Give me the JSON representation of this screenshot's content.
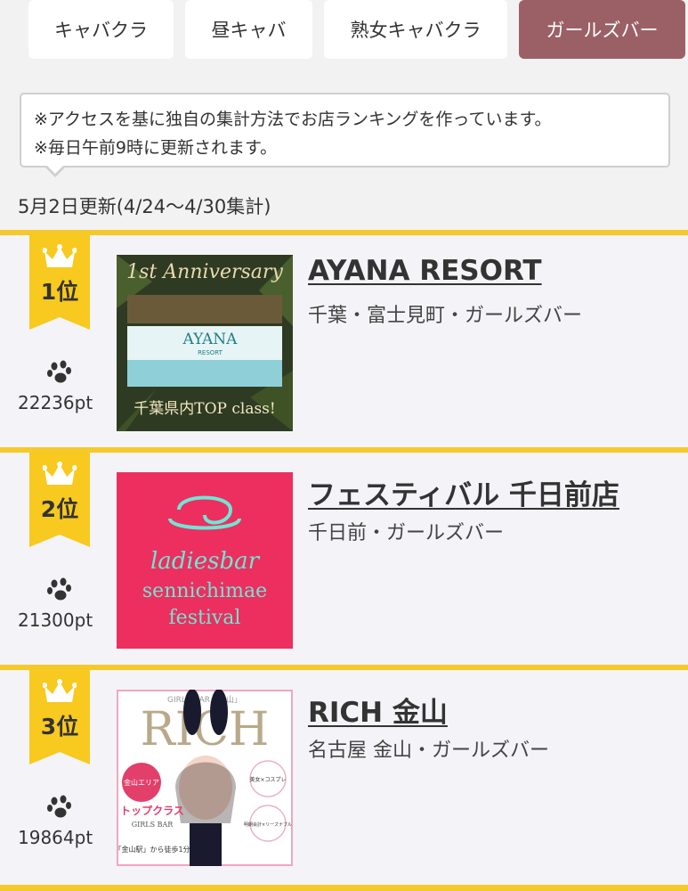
{
  "tabs": [
    {
      "label": "キャバクラ",
      "active": false
    },
    {
      "label": "昼キャバ",
      "active": false
    },
    {
      "label": "熟女キャバクラ",
      "active": false
    },
    {
      "label": "ガールズバー",
      "active": true
    }
  ],
  "notice": {
    "line1": "※アクセスを基に独自の集計方法でお店ランキングを作っています。",
    "line2": "※毎日午前9時に更新されます。"
  },
  "update_text": "5月2日更新(4/24〜4/30集計)",
  "rankings": [
    {
      "rank": "1位",
      "points": "22236pt",
      "name": "AYANA RESORT",
      "area": "千葉・富士見町・ガールズバー",
      "image_text": {
        "top": "1st Anniversary",
        "logo": "AYANA",
        "sub": "RESORT",
        "bottom": "千葉県内TOP class!"
      }
    },
    {
      "rank": "2位",
      "points": "21300pt",
      "name": "フェスティバル 千日前店",
      "area": "千日前・ガールズバー",
      "image_text": {
        "l1": "ladiesbar",
        "l2": "sennichimae",
        "l3": "festival"
      }
    },
    {
      "rank": "3位",
      "points": "19864pt",
      "name": "RICH 金山",
      "area": "名古屋 金山・ガールズバー",
      "image_text": {
        "top": "GIRLS BAR「金山」",
        "title": "RICH",
        "area_badge": "金山エリア",
        "class": "トップクラス",
        "sub": "GIRLS BAR",
        "station": "「金山駅」から徒歩1分",
        "c1": "美女×コスプレ",
        "c2": "明朗会計×リーズナブル"
      }
    }
  ],
  "colors": {
    "accent": "#9b6066",
    "ribbon": "#f8c91e",
    "border": "#f6c92a"
  }
}
